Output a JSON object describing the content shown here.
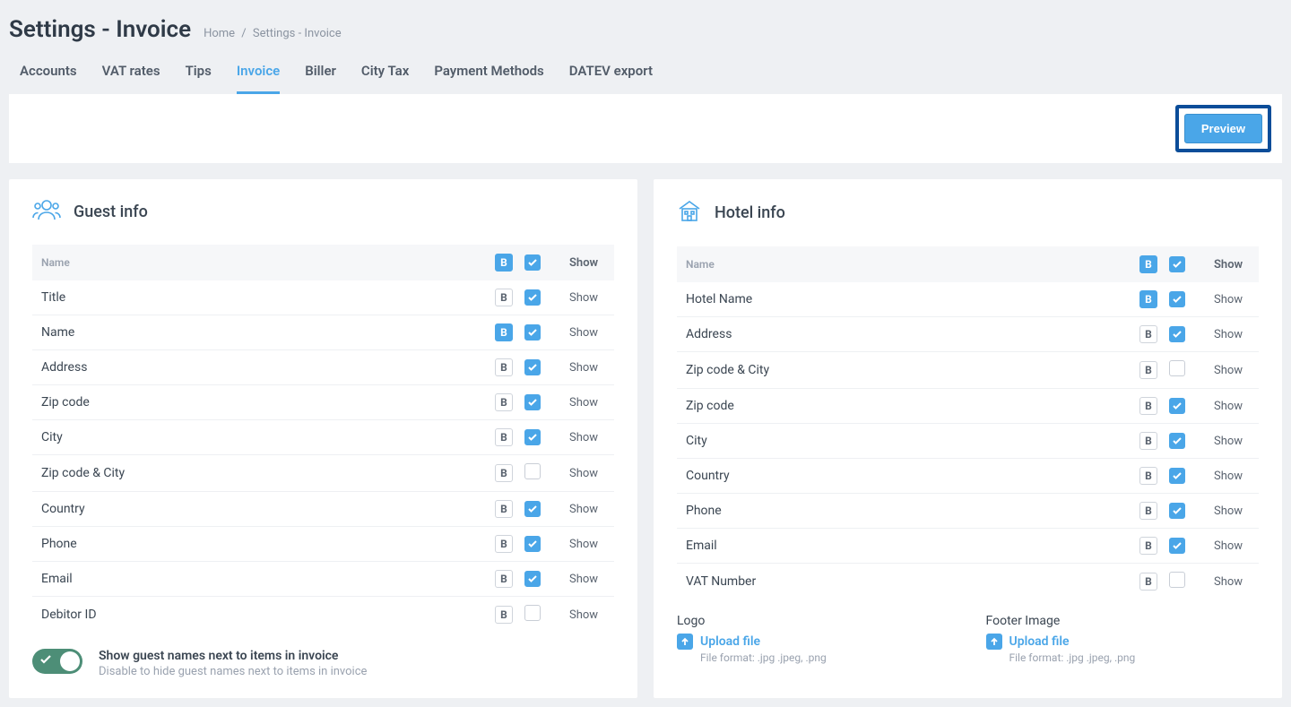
{
  "page_title": "Settings - Invoice",
  "breadcrumb": {
    "items": [
      "Home",
      "Settings - Invoice"
    ]
  },
  "tabs": {
    "items": [
      "Accounts",
      "VAT rates",
      "Tips",
      "Invoice",
      "Biller",
      "City Tax",
      "Payment Methods",
      "DATEV export"
    ],
    "active_index": 3
  },
  "preview_label": "Preview",
  "columns": {
    "name": "Name",
    "bold": "B",
    "show": "Show"
  },
  "guest": {
    "title": "Guest info",
    "header": {
      "bold_on": true,
      "show_on": true
    },
    "rows": [
      {
        "label": "Title",
        "bold": false,
        "show": true
      },
      {
        "label": "Name",
        "bold": true,
        "show": true
      },
      {
        "label": "Address",
        "bold": false,
        "show": true
      },
      {
        "label": "Zip code",
        "bold": false,
        "show": true
      },
      {
        "label": "City",
        "bold": false,
        "show": true
      },
      {
        "label": "Zip code & City",
        "bold": false,
        "show": false
      },
      {
        "label": "Country",
        "bold": false,
        "show": true
      },
      {
        "label": "Phone",
        "bold": false,
        "show": true
      },
      {
        "label": "Email",
        "bold": false,
        "show": true
      },
      {
        "label": "Debitor ID",
        "bold": false,
        "show": false
      }
    ],
    "toggle": {
      "on": true,
      "title": "Show guest names next to items in invoice",
      "subtitle": "Disable to hide guest names next to items in invoice"
    }
  },
  "hotel": {
    "title": "Hotel info",
    "header": {
      "bold_on": true,
      "show_on": true
    },
    "rows": [
      {
        "label": "Hotel Name",
        "bold": true,
        "show": true
      },
      {
        "label": "Address",
        "bold": false,
        "show": true
      },
      {
        "label": "Zip code & City",
        "bold": false,
        "show": false
      },
      {
        "label": "Zip code",
        "bold": false,
        "show": true
      },
      {
        "label": "City",
        "bold": false,
        "show": true
      },
      {
        "label": "Country",
        "bold": false,
        "show": true
      },
      {
        "label": "Phone",
        "bold": false,
        "show": true
      },
      {
        "label": "Email",
        "bold": false,
        "show": true
      },
      {
        "label": "VAT Number",
        "bold": false,
        "show": false
      }
    ],
    "uploads": {
      "logo": {
        "title": "Logo",
        "action": "Upload file",
        "hint": "File format: .jpg .jpeg, .png"
      },
      "footer": {
        "title": "Footer Image",
        "action": "Upload file",
        "hint": "File format: .jpg .jpeg, .png"
      }
    }
  }
}
